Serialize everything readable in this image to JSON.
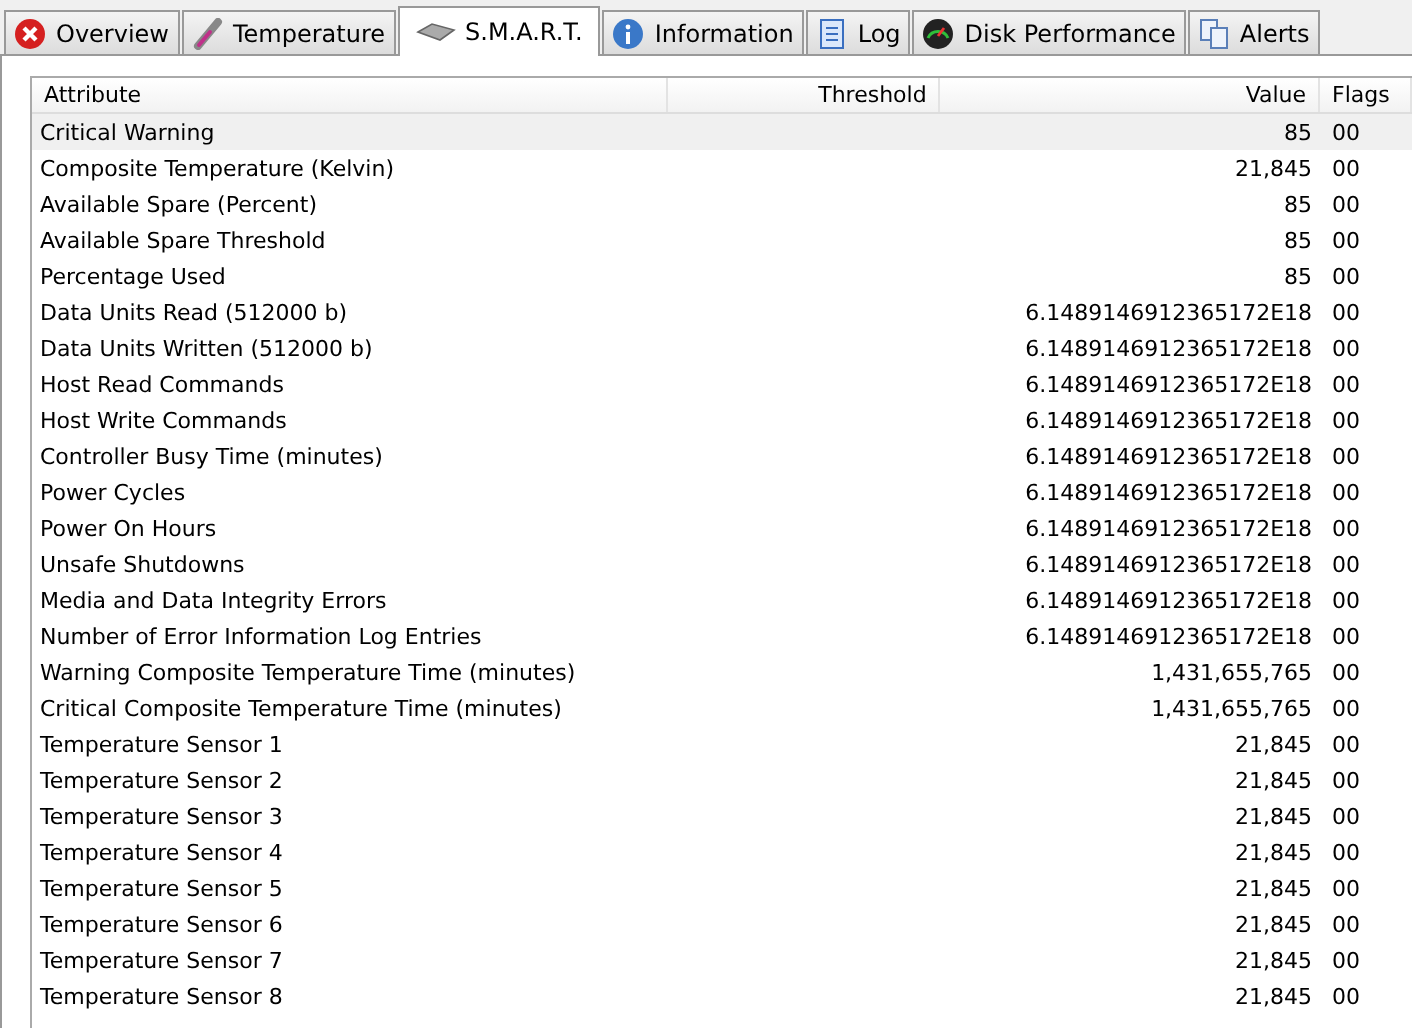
{
  "tabs": [
    {
      "label": "Overview",
      "kind": "error",
      "selected": false
    },
    {
      "label": "Temperature",
      "kind": "thermometer",
      "selected": false
    },
    {
      "label": "S.M.A.R.T.",
      "kind": "drive",
      "selected": true
    },
    {
      "label": "Information",
      "kind": "info",
      "selected": false
    },
    {
      "label": "Log",
      "kind": "document",
      "selected": false
    },
    {
      "label": "Disk Performance",
      "kind": "gauge",
      "selected": false
    },
    {
      "label": "Alerts",
      "kind": "pages",
      "selected": false
    }
  ],
  "table": {
    "columns": [
      "Attribute",
      "Threshold",
      "Value",
      "Flags"
    ],
    "rows": [
      {
        "attribute": "Critical Warning",
        "value": "85",
        "flags": "00",
        "selected": true
      },
      {
        "attribute": "Composite Temperature (Kelvin)",
        "value": "21,845",
        "flags": "00",
        "selected": false
      },
      {
        "attribute": "Available Spare (Percent)",
        "value": "85",
        "flags": "00",
        "selected": false
      },
      {
        "attribute": "Available Spare Threshold",
        "value": "85",
        "flags": "00",
        "selected": false
      },
      {
        "attribute": "Percentage Used",
        "value": "85",
        "flags": "00",
        "selected": false
      },
      {
        "attribute": "Data Units Read (512000 b)",
        "value": "6.1489146912365172E18",
        "flags": "00",
        "selected": false
      },
      {
        "attribute": "Data Units Written (512000 b)",
        "value": "6.1489146912365172E18",
        "flags": "00",
        "selected": false
      },
      {
        "attribute": "Host Read Commands",
        "value": "6.1489146912365172E18",
        "flags": "00",
        "selected": false
      },
      {
        "attribute": "Host Write Commands",
        "value": "6.1489146912365172E18",
        "flags": "00",
        "selected": false
      },
      {
        "attribute": "Controller Busy Time (minutes)",
        "value": "6.1489146912365172E18",
        "flags": "00",
        "selected": false
      },
      {
        "attribute": "Power Cycles",
        "value": "6.1489146912365172E18",
        "flags": "00",
        "selected": false
      },
      {
        "attribute": "Power On Hours",
        "value": "6.1489146912365172E18",
        "flags": "00",
        "selected": false
      },
      {
        "attribute": "Unsafe Shutdowns",
        "value": "6.1489146912365172E18",
        "flags": "00",
        "selected": false
      },
      {
        "attribute": "Media and Data Integrity Errors",
        "value": "6.1489146912365172E18",
        "flags": "00",
        "selected": false
      },
      {
        "attribute": "Number of Error Information Log Entries",
        "value": "6.1489146912365172E18",
        "flags": "00",
        "selected": false
      },
      {
        "attribute": "Warning Composite Temperature Time (minutes)",
        "value": "1,431,655,765",
        "flags": "00",
        "selected": false
      },
      {
        "attribute": "Critical Composite Temperature Time (minutes)",
        "value": "1,431,655,765",
        "flags": "00",
        "selected": false
      },
      {
        "attribute": "Temperature Sensor 1",
        "value": "21,845",
        "flags": "00",
        "selected": false
      },
      {
        "attribute": "Temperature Sensor 2",
        "value": "21,845",
        "flags": "00",
        "selected": false
      },
      {
        "attribute": "Temperature Sensor 3",
        "value": "21,845",
        "flags": "00",
        "selected": false
      },
      {
        "attribute": "Temperature Sensor 4",
        "value": "21,845",
        "flags": "00",
        "selected": false
      },
      {
        "attribute": "Temperature Sensor 5",
        "value": "21,845",
        "flags": "00",
        "selected": false
      },
      {
        "attribute": "Temperature Sensor 6",
        "value": "21,845",
        "flags": "00",
        "selected": false
      },
      {
        "attribute": "Temperature Sensor 7",
        "value": "21,845",
        "flags": "00",
        "selected": false
      },
      {
        "attribute": "Temperature Sensor 8",
        "value": "21,845",
        "flags": "00",
        "selected": false
      }
    ]
  }
}
